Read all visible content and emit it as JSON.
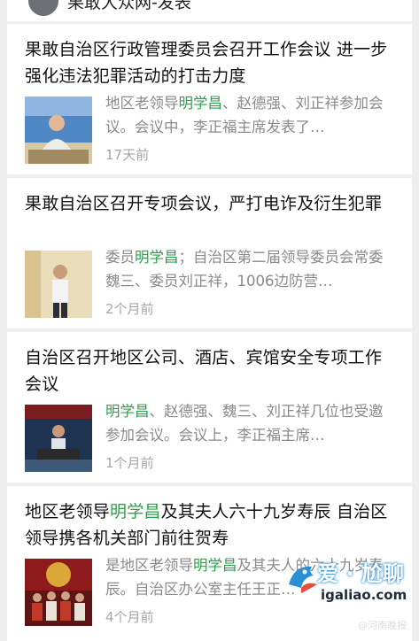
{
  "header": {
    "account_name": "果敢大众网-发表"
  },
  "articles": [
    {
      "title": "果敢自治区行政管理委员会召开工作会议 进一步强化违法犯罪活动的打击力度",
      "snippet_before": "地区老领导",
      "highlight": "明学昌",
      "snippet_after": "、赵德强、刘正祥参加会议。会议中，李正福主席发表了…",
      "time": "17天前"
    },
    {
      "title": "果敢自治区召开专项会议，严打电诈及衍生犯罪",
      "snippet_before": "委员",
      "highlight": "明学昌",
      "snippet_after": "；自治区第二届领导委员会常委魏三、委员刘正祥，1006边防营…",
      "time": "2个月前"
    },
    {
      "title": "自治区召开地区公司、酒店、宾馆安全专项工作会议",
      "snippet_before": "",
      "highlight": "明学昌",
      "snippet_after": "、赵德强、魏三、刘正祥几位也受邀参加会议。会议上，李正福主席…",
      "time": "1个月前"
    },
    {
      "title_before": "地区老领导",
      "title_highlight": "明学昌",
      "title_after": "及其夫人六十九岁寿辰 自治区领导携各机关部门前往贺寿",
      "snippet_before": "是地区老领导",
      "highlight": "明学昌",
      "snippet_after": "及其夫人的六十九岁寿辰。自治区办公室主任王正…",
      "time": "4个月前"
    }
  ],
  "watermark": {
    "brand": "爱 · 尬聊",
    "site": "igaliao.com",
    "source": "@河南晚报"
  },
  "colors": {
    "highlight": "#2fa14e",
    "snippet": "#8a8a8a",
    "time": "#a6a6a6"
  }
}
